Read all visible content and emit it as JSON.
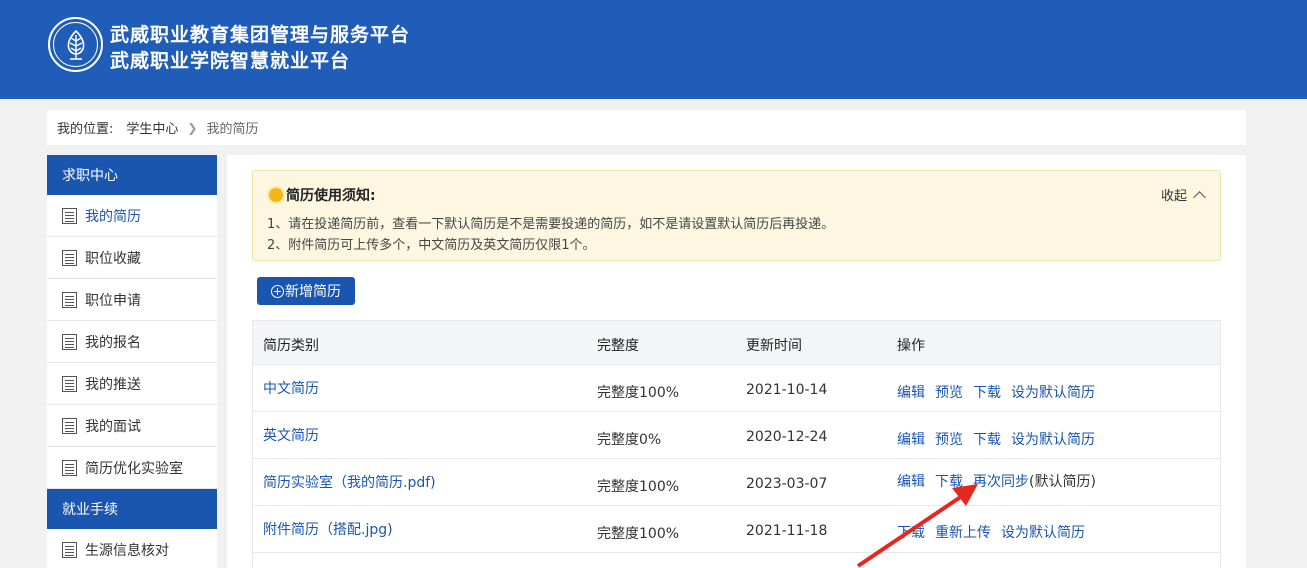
{
  "header": {
    "title_line1": "武威职业教育集团管理与服务平台",
    "title_line2": "武威职业学院智慧就业平台",
    "logo_icon": "school-emblem-icon",
    "bg_color": "#1f5db8"
  },
  "breadcrumb": {
    "label": "我的位置:",
    "items": [
      "学生中心",
      "我的简历"
    ]
  },
  "sidebar": {
    "section1": "求职中心",
    "items1": [
      "我的简历",
      "职位收藏",
      "职位申请",
      "我的报名",
      "我的推送",
      "我的面试",
      "简历优化实验室"
    ],
    "active": "我的简历",
    "section2": "就业手续",
    "items2": [
      "生源信息核对"
    ]
  },
  "notice": {
    "title": "简历使用须知:",
    "line1": "1、请在投递简历前，查看一下默认简历是不是需要投递的简历，如不是请设置默认简历后再投递。",
    "line2": "2、附件简历可上传多个，中文简历及英文简历仅限1个。",
    "collapse_label": "收起"
  },
  "add_button": "新增简历",
  "table": {
    "headers": [
      "简历类别",
      "完整度",
      "更新时间",
      "操作"
    ],
    "rows": [
      {
        "name": "中文简历",
        "completeness": "完整度100%",
        "updated": "2021-10-14",
        "ops": [
          "编辑",
          "预览",
          "下载",
          "设为默认简历"
        ],
        "note": ""
      },
      {
        "name": "英文简历",
        "completeness": "完整度0%",
        "updated": "2020-12-24",
        "ops": [
          "编辑",
          "预览",
          "下载",
          "设为默认简历"
        ],
        "note": ""
      },
      {
        "name": "简历实验室（我的简历.pdf)",
        "completeness": "完整度100%",
        "updated": "2023-03-07",
        "ops": [
          "编辑",
          "下载",
          "再次同步"
        ],
        "note": "(默认简历)"
      },
      {
        "name": "附件简历（搭配.jpg)",
        "completeness": "完整度100%",
        "updated": "2021-11-18",
        "ops": [
          "下载",
          "重新上传",
          "设为默认简历"
        ],
        "note": ""
      }
    ]
  },
  "colors": {
    "accent": "#1a56b0",
    "annotation_arrow": "#e5281f"
  }
}
